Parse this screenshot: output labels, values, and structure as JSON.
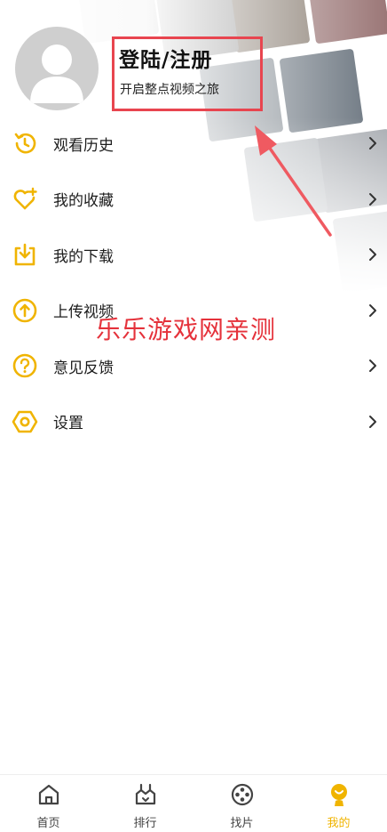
{
  "user": {
    "login_title": "登陆/注册",
    "login_subtitle": "开启整点视频之旅"
  },
  "menu": {
    "items": [
      {
        "label": "观看历史",
        "icon": "history-icon"
      },
      {
        "label": "我的收藏",
        "icon": "heart-plus-icon"
      },
      {
        "label": "我的下载",
        "icon": "download-icon"
      },
      {
        "label": "上传视频",
        "icon": "upload-icon"
      },
      {
        "label": "意见反馈",
        "icon": "feedback-icon"
      },
      {
        "label": "设置",
        "icon": "settings-icon"
      }
    ]
  },
  "watermark": "乐乐游戏网亲测",
  "tabbar": {
    "tabs": [
      {
        "label": "首页",
        "icon": "home-icon"
      },
      {
        "label": "排行",
        "icon": "ranking-icon"
      },
      {
        "label": "找片",
        "icon": "film-reel-icon"
      },
      {
        "label": "我的",
        "icon": "profile-icon",
        "active": true
      }
    ]
  },
  "colors": {
    "accent": "#f0b400",
    "highlight_box": "#e8454f",
    "watermark": "#e5323b"
  }
}
